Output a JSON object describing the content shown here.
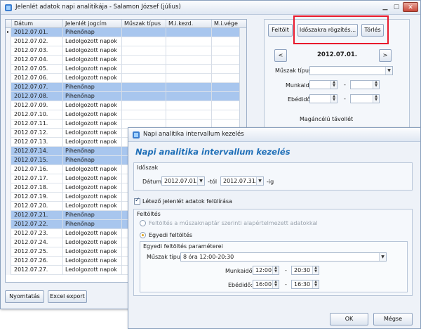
{
  "main_window": {
    "title": "Jelenlét adatok napi analitikája - Salamon József (július)",
    "columns": [
      "Dátum",
      "Jelenlét jogcím",
      "Műszak típus",
      "M.i.kezd.",
      "M.i.vége"
    ],
    "rows": [
      {
        "date": "2012.07.01.",
        "type": "Pihenőnap",
        "selected": true
      },
      {
        "date": "2012.07.02.",
        "type": "Ledolgozott napok",
        "selected": false
      },
      {
        "date": "2012.07.03.",
        "type": "Ledolgozott napok",
        "selected": false
      },
      {
        "date": "2012.07.04.",
        "type": "Ledolgozott napok",
        "selected": false
      },
      {
        "date": "2012.07.05.",
        "type": "Ledolgozott napok",
        "selected": false
      },
      {
        "date": "2012.07.06.",
        "type": "Ledolgozott napok",
        "selected": false
      },
      {
        "date": "2012.07.07.",
        "type": "Pihenőnap",
        "selected": true
      },
      {
        "date": "2012.07.08.",
        "type": "Pihenőnap",
        "selected": true
      },
      {
        "date": "2012.07.09.",
        "type": "Ledolgozott napok",
        "selected": false
      },
      {
        "date": "2012.07.10.",
        "type": "Ledolgozott napok",
        "selected": false
      },
      {
        "date": "2012.07.11.",
        "type": "Ledolgozott napok",
        "selected": false
      },
      {
        "date": "2012.07.12.",
        "type": "Ledolgozott napok",
        "selected": false
      },
      {
        "date": "2012.07.13.",
        "type": "Ledolgozott napok",
        "selected": false
      },
      {
        "date": "2012.07.14.",
        "type": "Pihenőnap",
        "selected": true
      },
      {
        "date": "2012.07.15.",
        "type": "Pihenőnap",
        "selected": true
      },
      {
        "date": "2012.07.16.",
        "type": "Ledolgozott napok",
        "selected": false
      },
      {
        "date": "2012.07.17.",
        "type": "Ledolgozott napok",
        "selected": false
      },
      {
        "date": "2012.07.18.",
        "type": "Ledolgozott napok",
        "selected": false
      },
      {
        "date": "2012.07.19.",
        "type": "Ledolgozott napok",
        "selected": false
      },
      {
        "date": "2012.07.20.",
        "type": "Ledolgozott napok",
        "selected": false
      },
      {
        "date": "2012.07.21.",
        "type": "Pihenőnap",
        "selected": true
      },
      {
        "date": "2012.07.22.",
        "type": "Pihenőnap",
        "selected": true
      },
      {
        "date": "2012.07.23.",
        "type": "Ledolgozott napok",
        "selected": false
      },
      {
        "date": "2012.07.24.",
        "type": "Ledolgozott napok",
        "selected": false
      },
      {
        "date": "2012.07.25.",
        "type": "Ledolgozott napok",
        "selected": false
      },
      {
        "date": "2012.07.26.",
        "type": "Ledolgozott napok",
        "selected": false
      },
      {
        "date": "2012.07.27.",
        "type": "Ledolgozott napok",
        "selected": false
      }
    ],
    "buttons": {
      "print": "Nyomtatás",
      "excel": "Excel export"
    }
  },
  "right_panel": {
    "fill_button": "Feltölt",
    "interval_button": "Időszakra rögzítés...",
    "delete_button": "Törlés",
    "current_date": "2012.07.01.",
    "prev": "<",
    "next": ">",
    "shift_type_label": "Műszak típus",
    "shift_type_value": "",
    "work_time_label": "Munkaidő",
    "lunch_label": "Ebédidő",
    "dash": "-",
    "private_absence_label": "Magáncélú távollét"
  },
  "dialog": {
    "title": "Napi analitika intervallum kezelés",
    "heading": "Napi analitika intervallum kezelés",
    "period_group": "Időszak",
    "date_label": "Dátum:",
    "date_from": "2012.07.01.",
    "from_suffix": "-tól",
    "date_to": "2012.07.31.",
    "to_suffix": "-ig",
    "overwrite_label": "Létező jelenlét adatok felülírása",
    "overwrite_checked": true,
    "fill_group": "Feltöltés",
    "fill_option_default": "Feltöltés a műszaknaptár szerinti alapértelmezett adatokkal",
    "fill_option_custom": "Egyedi feltöltés",
    "custom_group": "Egyedi feltöltés paraméterei",
    "shift_type_label": "Műszak típus:",
    "shift_type_value": "8 óra 12:00-20:30",
    "work_time_label": "Munkaidő:",
    "work_from": "12:00",
    "work_to": "20:30",
    "lunch_label": "Ebédidő:",
    "lunch_from": "16:00",
    "lunch_to": "16:30",
    "dash": "-",
    "ok_button": "OK",
    "cancel_button": "Mégse"
  },
  "colors": {
    "selected_row": "#a8c6ee",
    "highlight_box": "#e8192c",
    "dialog_heading": "#1f6fb7"
  }
}
